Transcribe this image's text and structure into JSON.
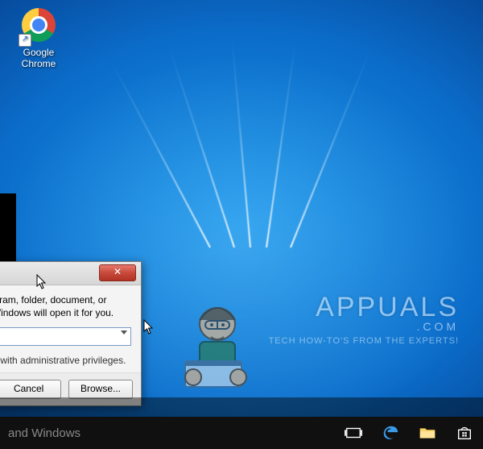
{
  "desktop": {
    "icons": [
      {
        "name": "google-chrome",
        "label": "Google\nChrome"
      }
    ]
  },
  "run_dialog": {
    "description": "r, document, or Internet t for you.",
    "description_full": "Type the name of a program, folder, document, or Internet resource, and Windows will open it for you.",
    "admin_note": "administrative privileges.",
    "admin_note_full": "This task will be created with administrative privileges.",
    "buttons": {
      "cancel": "ncel",
      "cancel_full": "Cancel",
      "browse": "Browse..."
    },
    "close_glyph": "✕"
  },
  "taskbar": {
    "search_placeholder": "and Windows",
    "search_placeholder_full": "Search the web and Windows",
    "icons": {
      "taskview": "task-view-icon",
      "edge": "edge-icon",
      "explorer": "file-explorer-icon",
      "store": "store-icon"
    }
  },
  "watermark": {
    "title": "APPUALS",
    "dotcom": ".COM",
    "tagline": "TECH HOW-TO'S FROM THE EXPERTS!"
  }
}
